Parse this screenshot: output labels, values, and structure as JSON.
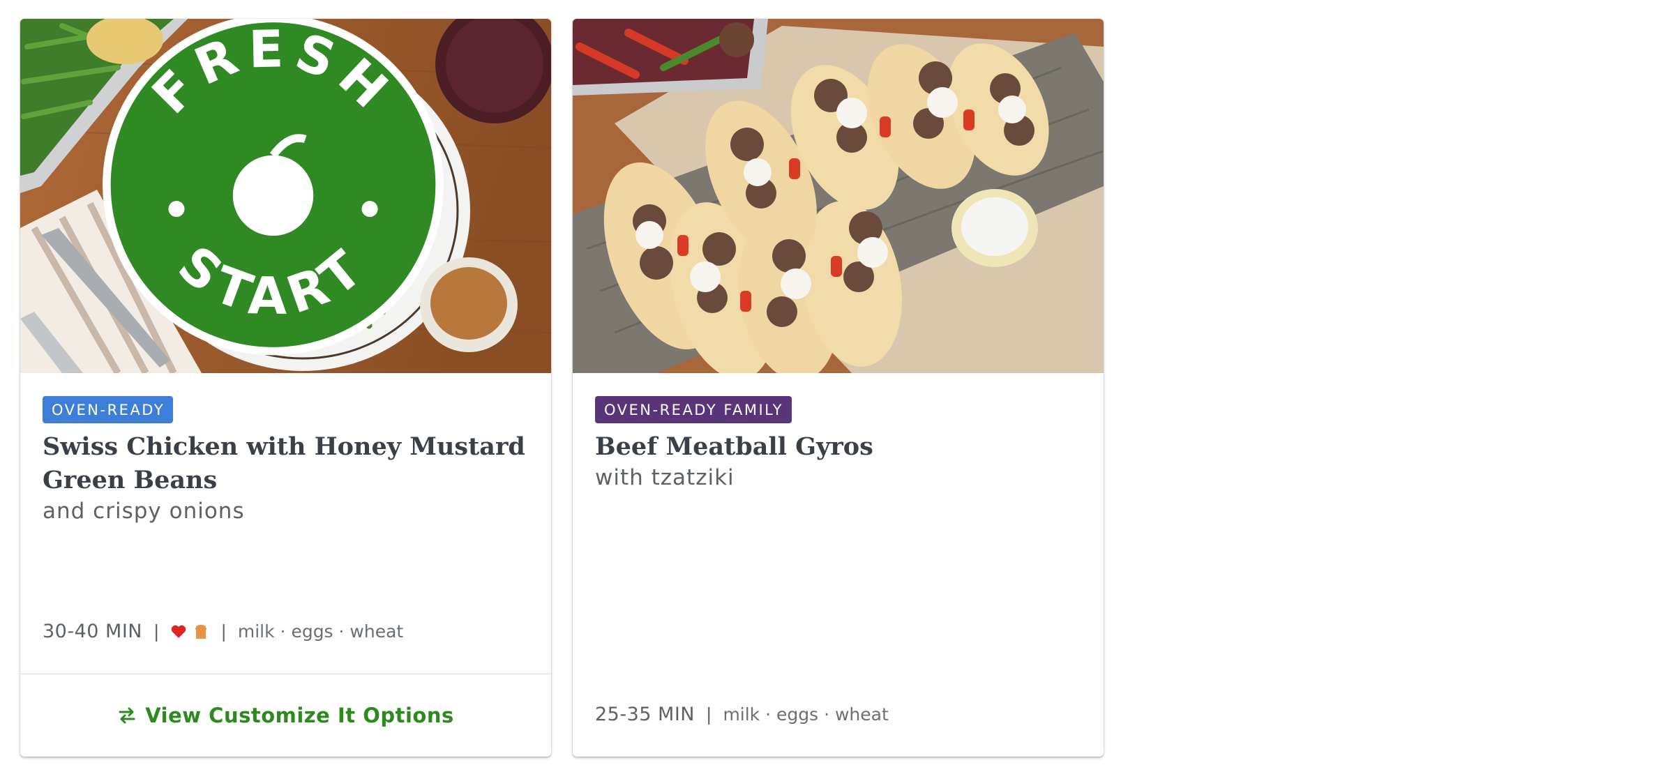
{
  "cards": [
    {
      "tag": "OVEN-READY",
      "tag_color": "#3d7fd8",
      "title": "Swiss Chicken with Honey Mustard Green Beans",
      "subtitle": "and crispy onions",
      "time": "30-40 MIN",
      "allergens": "milk · eggs · wheat",
      "icons": [
        "heart-icon",
        "toast-icon"
      ],
      "badge": {
        "top": "FRESH",
        "bottom": "START"
      },
      "footer_label": "View Customize It Options"
    },
    {
      "tag": "OVEN-READY FAMILY",
      "tag_color": "#5a3478",
      "title": "Beef Meatball Gyros",
      "subtitle": "with tzatziki",
      "time": "25-35 MIN",
      "allergens": "milk · eggs · wheat"
    }
  ],
  "colors": {
    "accent_green": "#2c8a1e",
    "text_dark": "#3b4048"
  }
}
